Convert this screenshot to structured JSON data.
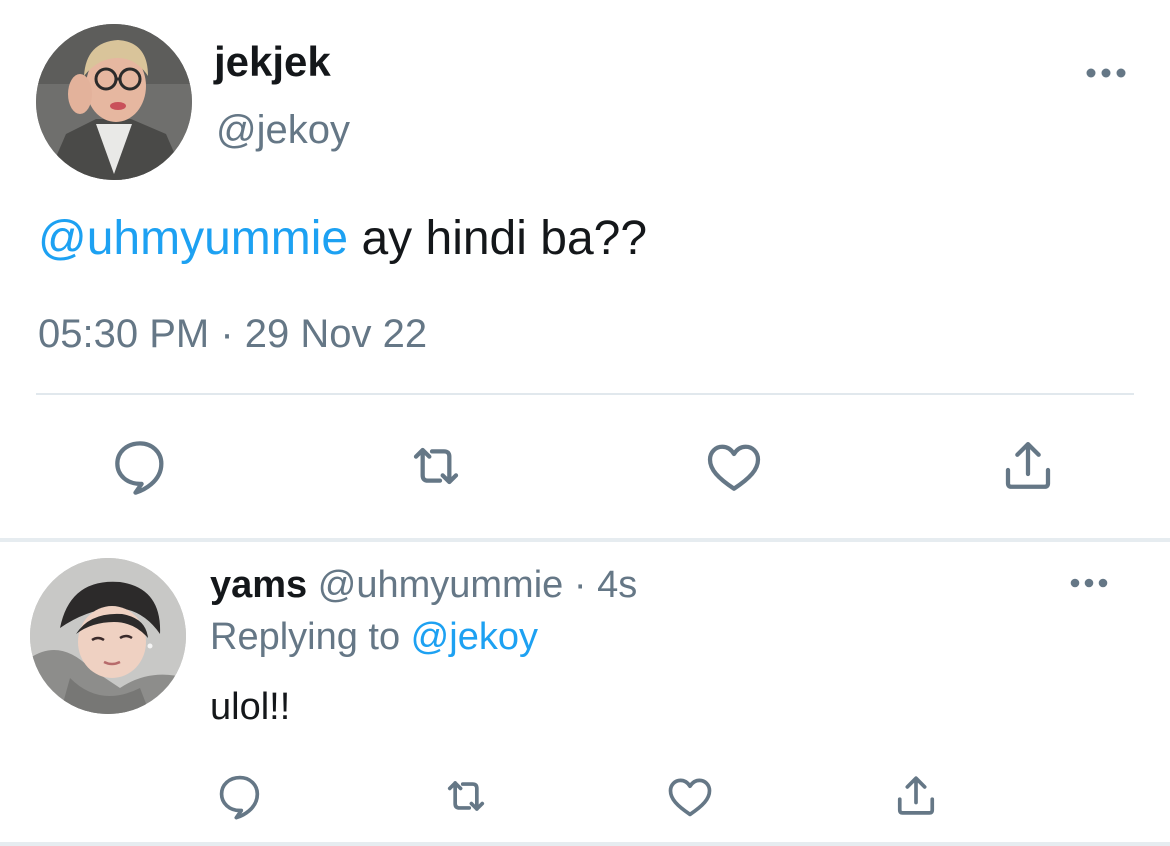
{
  "main_tweet": {
    "display_name": "jekjek",
    "handle": "@jekoy",
    "mention": "@uhmyummie",
    "text": " ay hindi ba??",
    "timestamp": "05:30 PM · 29 Nov 22",
    "icons": {
      "more": "more-horizontal-icon",
      "reply": "reply-icon",
      "retweet": "retweet-icon",
      "like": "heart-icon",
      "share": "share-icon"
    }
  },
  "reply_tweet": {
    "display_name": "yams",
    "handle": "@uhmyummie",
    "separator": " · ",
    "time_ago": "4s",
    "replying_prefix": "Replying to ",
    "replying_to": "@jekoy",
    "text": "ulol!!"
  },
  "colors": {
    "link": "#1da1f2",
    "secondary_text": "#657786",
    "icon": "#657786",
    "divider": "#e1e8ed"
  }
}
